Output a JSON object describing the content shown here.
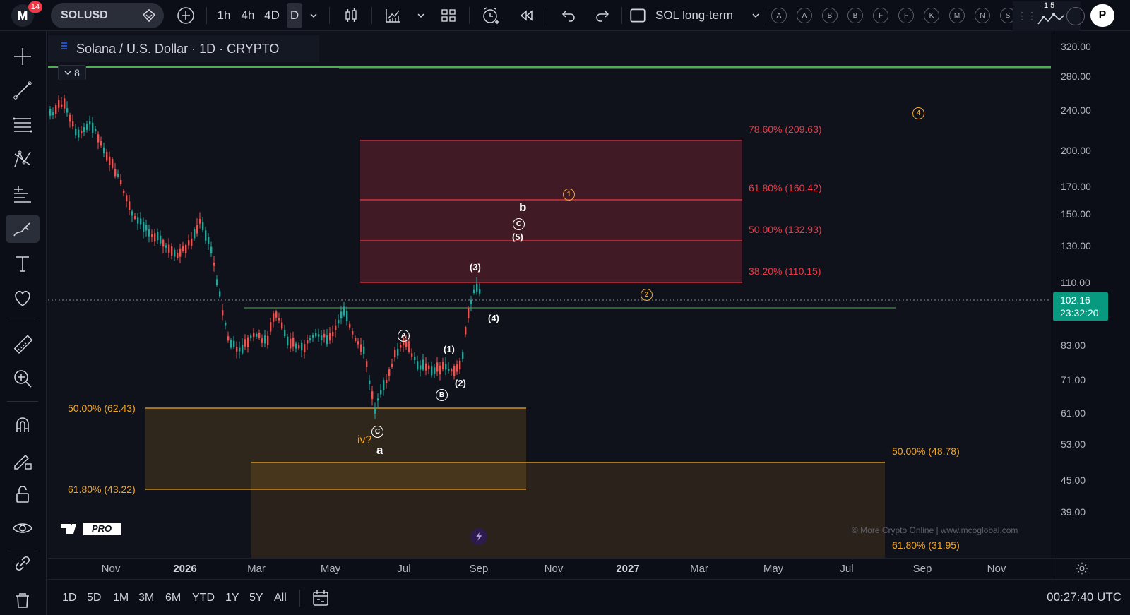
{
  "toolbar": {
    "notification_count": "14",
    "symbol": "SOLUSD",
    "intervals": [
      "1h",
      "4h",
      "4D",
      "D"
    ],
    "layout_name": "SOL long-term",
    "alert_letters": [
      "A",
      "A",
      "B",
      "B",
      "F",
      "F",
      "K",
      "M",
      "N",
      "S"
    ],
    "right_badge": "1 5",
    "publish_label": "P"
  },
  "legend": {
    "title": "Solana / U.S. Dollar · 1D · CRYPTO",
    "collapsed_count": "8"
  },
  "fib_levels_upper": [
    {
      "label": "78.60% (209.63)"
    },
    {
      "label": "61.80% (160.42)"
    },
    {
      "label": "50.00% (132.93)"
    },
    {
      "label": "38.20% (110.15)"
    }
  ],
  "fib_levels_lower_left": [
    {
      "label": "50.00% (62.43)"
    },
    {
      "label": "61.80% (43.22)"
    }
  ],
  "fib_levels_lower_right": [
    {
      "label": "50.00% (48.78)"
    },
    {
      "label": "61.80% (31.95)"
    }
  ],
  "waves": {
    "A": "A",
    "B": "B",
    "C_low": "C",
    "C_high": "C",
    "w1": "(1)",
    "w2": "(2)",
    "w3": "(3)",
    "w4": "(4)",
    "w5": "(5)",
    "a": "a",
    "b": "b",
    "iv": "iv?",
    "o1": "1",
    "o2": "2",
    "o4": "4"
  },
  "price_axis": {
    "labels": [
      "320.00",
      "280.00",
      "240.00",
      "200.00",
      "170.00",
      "150.00",
      "130.00",
      "110.00",
      "83.00",
      "71.00",
      "61.00",
      "53.00",
      "45.00",
      "39.00"
    ],
    "current_price": "102.16",
    "countdown": "23:32:20"
  },
  "time_axis": {
    "labels": [
      "Nov",
      "2026",
      "Mar",
      "May",
      "Jul",
      "Sep",
      "Nov",
      "2027",
      "Mar",
      "May",
      "Jul",
      "Sep",
      "Nov"
    ]
  },
  "watermark": {
    "brand": "PRO",
    "credit": "© More Crypto Online  |  www.mcoglobal.com"
  },
  "bottom": {
    "ranges": [
      "1D",
      "5D",
      "1M",
      "3M",
      "6M",
      "YTD",
      "1Y",
      "5Y",
      "All"
    ],
    "clock": "00:27:40 UTC"
  },
  "colors": {
    "up": "#26a69a",
    "down": "#ef5350",
    "fib_red": "#f23645",
    "fib_orange": "#f5a623",
    "green_line": "#4caf50",
    "current_price_bg": "#089981"
  }
}
